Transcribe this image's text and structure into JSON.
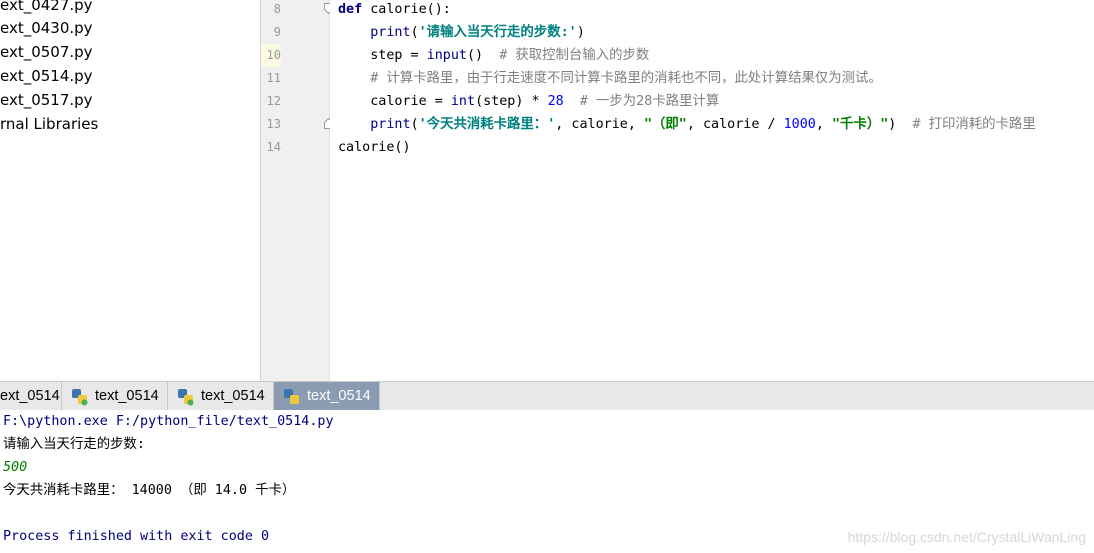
{
  "project_tree": {
    "items": [
      "ext_0427.py",
      "ext_0430.py",
      "ext_0507.py",
      "ext_0514.py",
      "ext_0517.py",
      "rnal Libraries"
    ]
  },
  "editor": {
    "line_numbers": [
      "8",
      "9",
      "10",
      "11",
      "12",
      "13",
      "14"
    ],
    "current_line": "10",
    "lines": [
      [
        {
          "t": "def",
          "c": "kw"
        },
        {
          "t": " calorie():",
          "c": "plain"
        }
      ],
      [
        {
          "t": "    ",
          "c": "plain"
        },
        {
          "t": "print",
          "c": "fn"
        },
        {
          "t": "(",
          "c": "plain"
        },
        {
          "t": "'请输入当天行走的步数:'",
          "c": "str"
        },
        {
          "t": ")",
          "c": "plain"
        }
      ],
      [
        {
          "t": "    step = ",
          "c": "plain"
        },
        {
          "t": "input",
          "c": "fn"
        },
        {
          "t": "()  ",
          "c": "plain"
        },
        {
          "t": "# 获取控制台输入的步数",
          "c": "com"
        }
      ],
      [
        {
          "t": "    ",
          "c": "plain"
        },
        {
          "t": "# 计算卡路里，由于行走速度不同计算卡路里的消耗也不同，此处计算结果仅为测试。",
          "c": "com"
        }
      ],
      [
        {
          "t": "    calorie = ",
          "c": "plain"
        },
        {
          "t": "int",
          "c": "fn"
        },
        {
          "t": "(step) * ",
          "c": "plain"
        },
        {
          "t": "28",
          "c": "num"
        },
        {
          "t": "  ",
          "c": "plain"
        },
        {
          "t": "# 一步为28卡路里计算",
          "c": "com"
        }
      ],
      [
        {
          "t": "    ",
          "c": "plain"
        },
        {
          "t": "print",
          "c": "fn"
        },
        {
          "t": "(",
          "c": "plain"
        },
        {
          "t": "'今天共消耗卡路里：'",
          "c": "str"
        },
        {
          "t": ", calorie, ",
          "c": "plain"
        },
        {
          "t": "\"（即\"",
          "c": "str2"
        },
        {
          "t": ", calorie / ",
          "c": "plain"
        },
        {
          "t": "1000",
          "c": "num"
        },
        {
          "t": ", ",
          "c": "plain"
        },
        {
          "t": "\"千卡）\"",
          "c": "str2"
        },
        {
          "t": ")  ",
          "c": "plain"
        },
        {
          "t": "# 打印消耗的卡路里",
          "c": "com"
        }
      ],
      [
        {
          "t": "calorie()",
          "c": "plain"
        }
      ]
    ]
  },
  "run_tabs": [
    {
      "label": "ext_0514",
      "icon": false,
      "active": false
    },
    {
      "label": "text_0514",
      "icon": true,
      "active": false
    },
    {
      "label": "text_0514",
      "icon": true,
      "active": false
    },
    {
      "label": "text_0514",
      "icon": true,
      "active": true
    }
  ],
  "console": {
    "command": "F:\\python.exe F:/python_file/text_0514.py",
    "prompt": "请输入当天行走的步数:",
    "user_input": "500",
    "result": "今天共消耗卡路里： 14000 （即 14.0 千卡）",
    "exit_message": "Process finished with exit code 0"
  },
  "watermark": "https://blog.csdn.net/CrystalLiWanLing",
  "colors": {
    "keyword": "#000080",
    "string": "#008080",
    "number": "#0000ff",
    "comment": "#808080",
    "current_line": "#fcfae1",
    "active_tab": "#8a9bb2",
    "console_input": "#008000"
  }
}
